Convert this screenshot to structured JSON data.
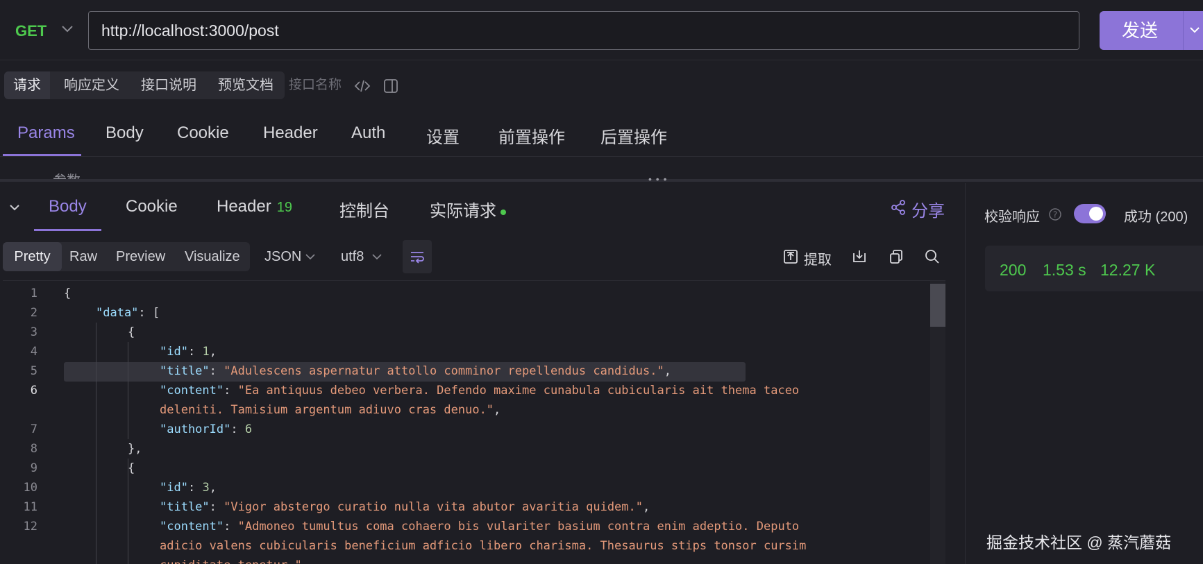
{
  "request": {
    "method": "GET",
    "url": "http://localhost:3000/post",
    "send_label": "发送"
  },
  "req_tabs": {
    "request": "请求",
    "response_def": "响应定义",
    "api_doc": "接口说明",
    "preview_doc": "预览文档",
    "api_name_placeholder": "接口名称"
  },
  "param_tabs": [
    "Params",
    "Body",
    "Cookie",
    "Header",
    "Auth",
    "设置",
    "前置操作",
    "后置操作"
  ],
  "param_partial": "参数",
  "response_tabs": {
    "body": "Body",
    "cookie": "Cookie",
    "header": "Header",
    "header_count": "19",
    "console": "控制台",
    "actual_request": "实际请求",
    "share": "分享"
  },
  "view_modes": [
    "Pretty",
    "Raw",
    "Preview",
    "Visualize"
  ],
  "format": "JSON",
  "encoding": "utf8",
  "toolbar": {
    "extract": "提取"
  },
  "editor": {
    "line_numbers": [
      "1",
      "2",
      "3",
      "4",
      "5",
      "6",
      "",
      "7",
      "8",
      "9",
      "10",
      "11",
      "12",
      "",
      ""
    ],
    "current_line": "6"
  },
  "code": {
    "l1": "{",
    "data_key": "\"data\"",
    "l2_rest": ": [",
    "l3": "{",
    "id_key": "\"id\"",
    "id1": "1",
    "title_key": "\"title\"",
    "title1": "\"Adulescens aspernatur attollo comminor repellendus candidus.\"",
    "content_key": "\"content\"",
    "content1_a": "\"Ea antiquus debeo verbera. Defendo maxime cunabula cubicularis ait thema taceo",
    "content1_b": "deleniti. Tamisium argentum adiuvo cras denuo.\"",
    "authorId_key": "\"authorId\"",
    "author1": "6",
    "l8": "},",
    "l9": "{",
    "id3": "3",
    "title3": "\"Vigor abstergo curatio nulla vita abutor avaritia quidem.\"",
    "content3_a": "\"Admoneo tumultus coma cohaero bis vulariter basium contra enim adeptio. Deputo",
    "content3_b": "adicio valens cubicularis beneficium adficio libero charisma. Thesaurus stips tonsor cursim",
    "content3_c": "cupiditate tenetur.\","
  },
  "validation": {
    "label": "校验响应",
    "enabled": true,
    "result": "成功 (200)"
  },
  "metrics": {
    "status": "200",
    "time": "1.53 s",
    "size": "12.27 K"
  },
  "watermark": "掘金技术社区 @ 蒸汽蘑菇",
  "colors": {
    "accent": "#8c74d8",
    "success": "#4ec94e",
    "json_key": "#9cdcfe",
    "json_string": "#e59a7a",
    "json_number": "#b5cea8"
  }
}
